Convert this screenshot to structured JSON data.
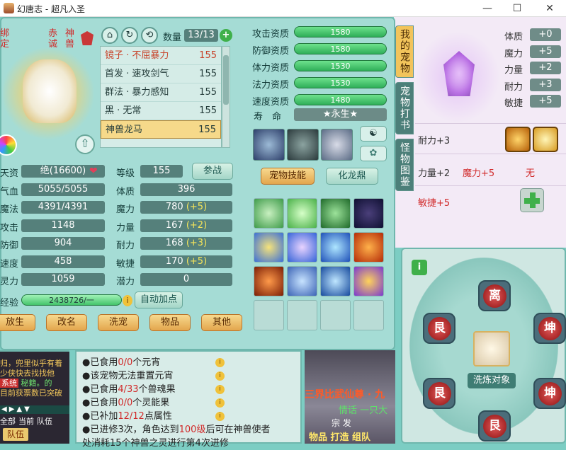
{
  "window": {
    "title": "幻唐志 - 超凡入圣",
    "minimize": "—",
    "maximize": "☐",
    "close": "✕"
  },
  "pet_side": {
    "tag_left": "绑定",
    "tag_right1": "赤诚",
    "tag_right2": "神兽"
  },
  "pet_list": {
    "count_label": "数量",
    "count": "13/13",
    "plus": "+",
    "items": [
      {
        "name": "镜子 · 不屈暴力",
        "level": "155"
      },
      {
        "name": "首发 · 速攻剑气",
        "level": "155"
      },
      {
        "name": "群法 · 暴力感知",
        "level": "155"
      },
      {
        "name": "黑 · 无常",
        "level": "155"
      },
      {
        "name": "神兽龙马",
        "level": "155"
      }
    ]
  },
  "aptitudes": [
    {
      "label": "攻击资质",
      "value": "1580"
    },
    {
      "label": "防御资质",
      "value": "1580"
    },
    {
      "label": "体力资质",
      "value": "1530"
    },
    {
      "label": "法力资质",
      "value": "1530"
    },
    {
      "label": "速度资质",
      "value": "1480"
    }
  ],
  "lifespan": {
    "label": "寿　命",
    "value": "★永生★"
  },
  "skill_tabs": {
    "pet_skill": "宠物技能",
    "transform": "化龙鼎"
  },
  "stats_left": [
    {
      "label": "天资",
      "value": "绝(16600)"
    },
    {
      "label": "气血",
      "value": "5055/5055"
    },
    {
      "label": "魔法",
      "value": "4391/4391"
    },
    {
      "label": "攻击",
      "value": "1148"
    },
    {
      "label": "防御",
      "value": "904"
    },
    {
      "label": "速度",
      "value": "458"
    },
    {
      "label": "灵力",
      "value": "1059"
    }
  ],
  "stats_right": [
    {
      "label": "等级",
      "value": "155",
      "bonus": ""
    },
    {
      "label": "体质",
      "value": "396",
      "bonus": ""
    },
    {
      "label": "魔力",
      "value": "780",
      "bonus": "(+5)"
    },
    {
      "label": "力量",
      "value": "167",
      "bonus": "(+2)"
    },
    {
      "label": "耐力",
      "value": "168",
      "bonus": "(+3)"
    },
    {
      "label": "敏捷",
      "value": "170",
      "bonus": "(+5)"
    },
    {
      "label": "潜力",
      "value": "0",
      "bonus": ""
    }
  ],
  "participate": "参战",
  "experience": {
    "label": "经验",
    "value": "2438726/一"
  },
  "auto_points": "自动加点",
  "bottom_buttons": [
    "放生",
    "改名",
    "洗宠",
    "物品",
    "其他"
  ],
  "vertical_tabs": [
    "我的宠物",
    "宠物打书",
    "怪物图鉴"
  ],
  "right_bonuses": [
    {
      "label": "体质",
      "value": "+0"
    },
    {
      "label": "魔力",
      "value": "+5"
    },
    {
      "label": "力量",
      "value": "+2"
    },
    {
      "label": "耐力",
      "value": "+3"
    },
    {
      "label": "敏捷",
      "value": "+5"
    }
  ],
  "refine_rows": [
    {
      "left": "耐力+3",
      "mid": "",
      "right": ""
    },
    {
      "left": "力量+2",
      "mid": "魔力+5",
      "right": "无"
    },
    {
      "left": "敏捷+5",
      "mid": "",
      "right": ""
    }
  ],
  "refine_target": "洗炼对象",
  "runes": [
    "离",
    "坤",
    "坤",
    "艮",
    "艮",
    "艮"
  ],
  "info_bullets": [
    {
      "pre": "●已食用",
      "hl": "0/0",
      "post": "个元宵"
    },
    {
      "pre": "●该宠物无法重置元宵",
      "hl": "",
      "post": ""
    },
    {
      "pre": "●已食用",
      "hl": "4/33",
      "post": "个兽魂果"
    },
    {
      "pre": "●已食用",
      "hl": "0/0",
      "post": "个灵能果"
    },
    {
      "pre": "●已补加",
      "hl": "12/12",
      "post": "点属性"
    },
    {
      "pre": "●已进修3次，角色达到",
      "hl": "100级",
      "post": "后可在神兽使者"
    }
  ],
  "info_cut": "处消耗15个神兽之灵进行第4次进修",
  "chat": {
    "system": "系统",
    "lines": [
      "归，兜里似乎有着",
      "少侠快去找找他",
      "秘籍。的",
      "目前获票数已突破"
    ],
    "tabs": [
      "全部",
      "当前",
      "队伍"
    ],
    "team": "队伍"
  },
  "banner": {
    "line1": "三界比武仙尊 · 九",
    "line2": "情话 一只大",
    "line3": "物品 打造 组队",
    "line4": "宗 发"
  },
  "colors": {
    "accent_red": "#d12a2a",
    "bonus_yellow": "#f5e55a",
    "bar_green": "#2fae58",
    "tab_gold": "#f2c45b"
  }
}
